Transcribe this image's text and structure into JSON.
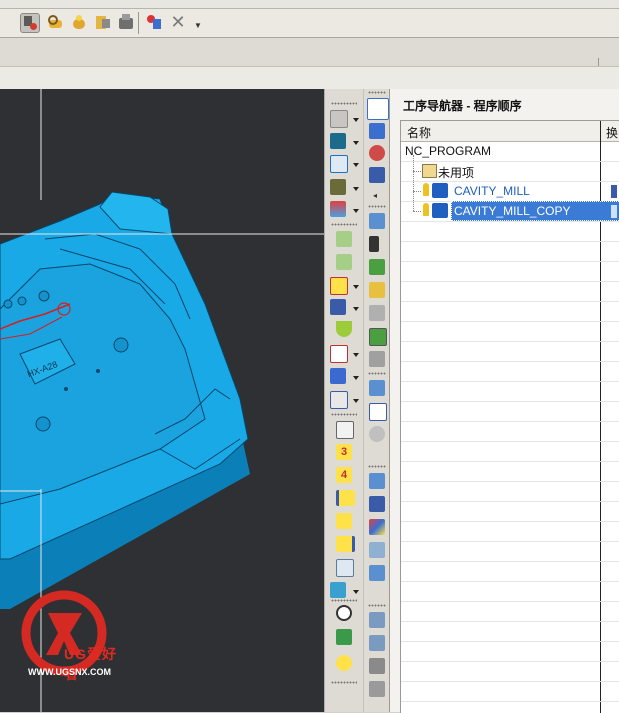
{
  "navigator": {
    "title": "工序导航器 - 程序顺序",
    "columns": {
      "name": "名称",
      "change": "换"
    },
    "rows": [
      {
        "label": "NC_PROGRAM"
      },
      {
        "label": "未用项"
      },
      {
        "label": "CAVITY_MILL"
      },
      {
        "label": "CAVITY_MILL_COPY",
        "selected": true
      }
    ]
  },
  "palette": {
    "numbers": [
      "3",
      "4"
    ]
  },
  "watermark": {
    "brand": "UG爱好者",
    "url": "WWW.UGSNX.COM"
  },
  "colors": {
    "viewport_bg": "#2e3033",
    "part": "#19a9e6",
    "part_dark": "#0b80b8",
    "selection": "#3a7bd5",
    "link_blue": "#1f5fbf"
  }
}
